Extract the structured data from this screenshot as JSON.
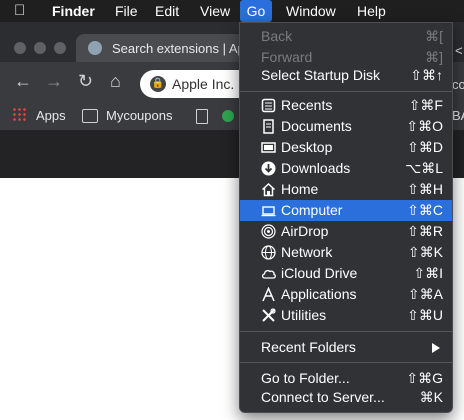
{
  "menubar": {
    "apple_icon": "apple-icon",
    "items": [
      "Finder",
      "File",
      "Edit",
      "View",
      "Go",
      "Window",
      "Help"
    ]
  },
  "browser": {
    "tab_title": "Search extensions | Ap",
    "site": "Apple Inc.",
    "bookmarks": {
      "apps": "Apps",
      "mycoupons": "Mycoupons"
    },
    "right_cut_1": "<",
    "right_cut_2": "co",
    "right_cut_3": "BA"
  },
  "go_menu": {
    "items": [
      {
        "label": "Back",
        "shortcut": "⌘[",
        "disabled": true
      },
      {
        "label": "Forward",
        "shortcut": "⌘]",
        "disabled": true
      },
      {
        "label": "Select Startup Disk",
        "shortcut": "⇧⌘↑"
      },
      {
        "label": "Recents",
        "shortcut": "⇧⌘F",
        "icon": "recents-icon"
      },
      {
        "label": "Documents",
        "shortcut": "⇧⌘O",
        "icon": "documents-icon"
      },
      {
        "label": "Desktop",
        "shortcut": "⇧⌘D",
        "icon": "desktop-icon"
      },
      {
        "label": "Downloads",
        "shortcut": "⌥⌘L",
        "icon": "downloads-icon"
      },
      {
        "label": "Home",
        "shortcut": "⇧⌘H",
        "icon": "home-icon"
      },
      {
        "label": "Computer",
        "shortcut": "⇧⌘C",
        "icon": "computer-icon",
        "selected": true
      },
      {
        "label": "AirDrop",
        "shortcut": "⇧⌘R",
        "icon": "airdrop-icon"
      },
      {
        "label": "Network",
        "shortcut": "⇧⌘K",
        "icon": "network-icon"
      },
      {
        "label": "iCloud Drive",
        "shortcut": "⇧⌘I",
        "icon": "icloud-icon"
      },
      {
        "label": "Applications",
        "shortcut": "⇧⌘A",
        "icon": "applications-icon"
      },
      {
        "label": "Utilities",
        "shortcut": "⇧⌘U",
        "icon": "utilities-icon"
      },
      {
        "label": "Recent Folders",
        "submenu": true
      },
      {
        "label": "Go to Folder...",
        "shortcut": "⇧⌘G"
      },
      {
        "label": "Connect to Server...",
        "shortcut": "⌘K"
      }
    ]
  },
  "colors": {
    "menubar_bg": "#1f1f1f",
    "menu_bg": "#313236",
    "highlight": "#2a6fdc"
  }
}
